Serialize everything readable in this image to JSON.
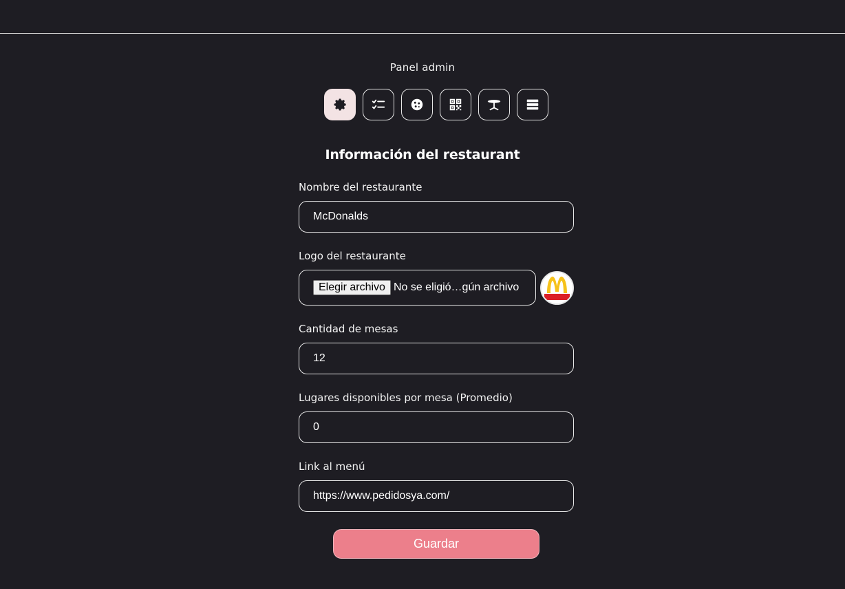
{
  "header": {
    "panel_title": "Panel admin"
  },
  "toolbar": {
    "icons": [
      {
        "name": "gear-icon",
        "active": true
      },
      {
        "name": "checklist-icon",
        "active": false
      },
      {
        "name": "cookie-icon",
        "active": false
      },
      {
        "name": "qr-code-icon",
        "active": false
      },
      {
        "name": "table-icon",
        "active": false
      },
      {
        "name": "list-icon",
        "active": false
      }
    ]
  },
  "form": {
    "title": "Información del restaurant",
    "name_label": "Nombre del restaurante",
    "name_value": "McDonalds",
    "logo_label": "Logo del restaurante",
    "file_button": "Elegir archivo",
    "file_status": "No se eligió…gún archivo",
    "logo_brand": "McDonald's",
    "tables_label": "Cantidad de mesas",
    "tables_value": "12",
    "seats_label": "Lugares disponibles por mesa (Promedio)",
    "seats_value": "0",
    "menu_label": "Link al menú",
    "menu_value": "https://www.pedidosya.com/",
    "save_label": "Guardar"
  },
  "colors": {
    "background": "#1e1d23",
    "accent": "#ec7f8b",
    "active_icon_bg": "#f3e3e4"
  }
}
